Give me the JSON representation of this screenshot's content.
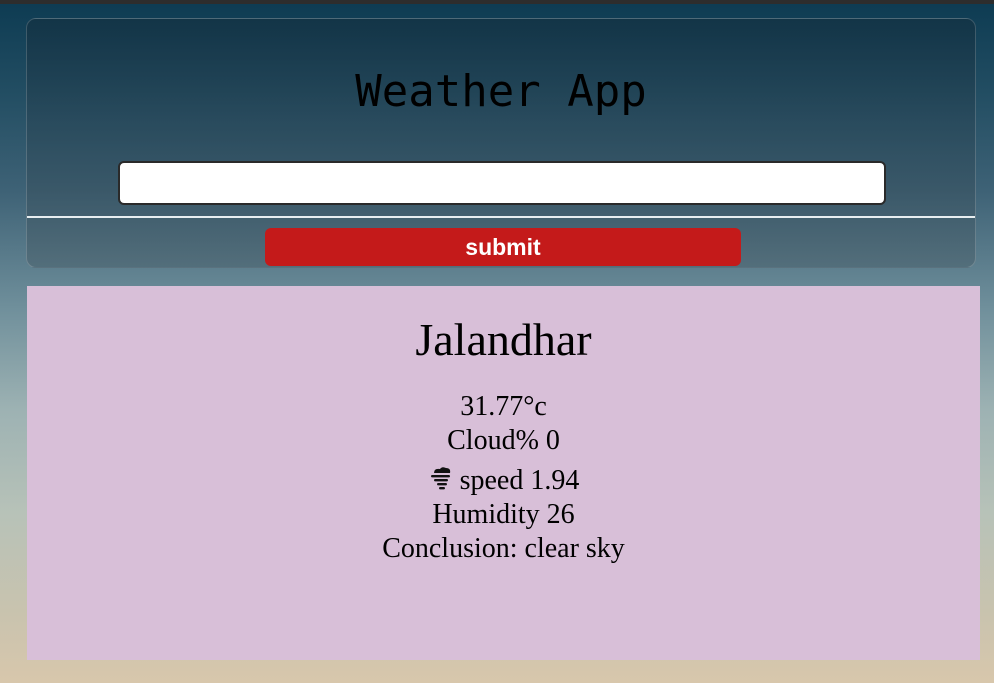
{
  "header": {
    "title": "Weather App",
    "search": {
      "value": "",
      "placeholder": ""
    },
    "submit_label": "submit"
  },
  "result": {
    "city": "Jalandhar",
    "temperature": "31.77°c",
    "cloud": "Cloud% 0",
    "wind_icon": "tornado-icon",
    "wind": "speed 1.94",
    "humidity": "Humidity 26",
    "conclusion": "Conclusion: clear sky"
  },
  "colors": {
    "submit_bg": "#c41a1a",
    "result_bg": "#d8bfd8"
  }
}
